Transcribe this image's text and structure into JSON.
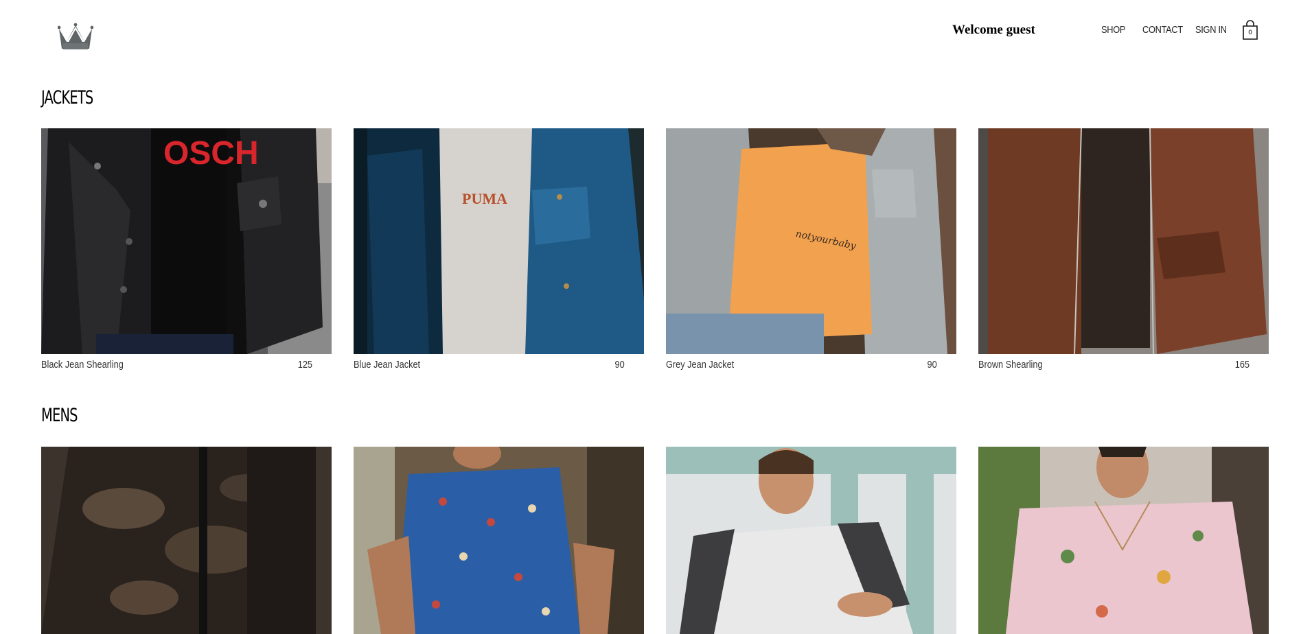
{
  "header": {
    "welcome": "Welcome guest",
    "nav": {
      "shop": "SHOP",
      "contact": "CONTACT",
      "sign_in": "SIGN IN"
    },
    "cart_count": "0",
    "logo_icon": "crown-icon",
    "cart_icon": "shopping-bag-icon"
  },
  "sections": [
    {
      "title": "JACKETS",
      "items": [
        {
          "name": "Black Jean Shearling",
          "price": "125"
        },
        {
          "name": "Blue Jean Jacket",
          "price": "90"
        },
        {
          "name": "Grey Jean Jacket",
          "price": "90"
        },
        {
          "name": "Brown Shearling",
          "price": "165"
        }
      ]
    },
    {
      "title": "MENS",
      "items": [
        {
          "name": "",
          "price": ""
        },
        {
          "name": "",
          "price": ""
        },
        {
          "name": "",
          "price": ""
        },
        {
          "name": "",
          "price": ""
        }
      ]
    }
  ],
  "colors": {
    "text": "#000000",
    "muted": "#333333",
    "logo": "#5f6566"
  }
}
